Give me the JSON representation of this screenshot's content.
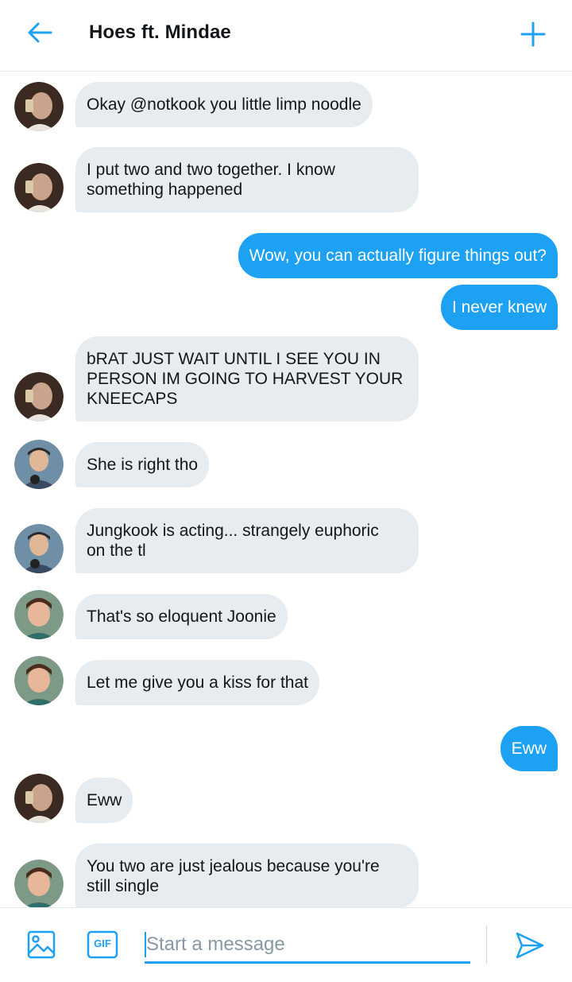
{
  "header": {
    "title": "Hoes ft. Mindae",
    "back_icon": "arrow-left-icon",
    "add_icon": "plus-icon"
  },
  "colors": {
    "accent": "#1da1f2",
    "incoming_bubble": "#e6ecf0",
    "divider": "#e1e8ed"
  },
  "messages": [
    {
      "sender": "a",
      "direction": "in",
      "text": "Okay @notkook you little limp noodle"
    },
    {
      "sender": "a",
      "direction": "in",
      "text": "I put two and two together. I know\nsomething happened"
    },
    {
      "sender": "me",
      "direction": "out",
      "text": "Wow, you can actually figure things out?"
    },
    {
      "sender": "me",
      "direction": "out",
      "text": "I never knew"
    },
    {
      "sender": "a",
      "direction": "in",
      "text": "bRAT JUST WAIT UNTIL I SEE YOU IN\nPERSON IM GOING TO HARVEST YOUR\nKNEECAPS"
    },
    {
      "sender": "b",
      "direction": "in",
      "text": "She is right tho"
    },
    {
      "sender": "b",
      "direction": "in",
      "text": "Jungkook is acting... strangely euphoric\non the tl"
    },
    {
      "sender": "c",
      "direction": "in",
      "text": "That's so eloquent Joonie"
    },
    {
      "sender": "c",
      "direction": "in",
      "text": "Let me give you a kiss for that"
    },
    {
      "sender": "me",
      "direction": "out",
      "text": "Eww"
    },
    {
      "sender": "a",
      "direction": "in",
      "text": "Eww"
    },
    {
      "sender": "c",
      "direction": "in",
      "text": "You two are just jealous because you're\nstill single"
    }
  ],
  "composer": {
    "placeholder": "Start a message",
    "value": "",
    "media_icon": "image-icon",
    "gif_label": "GIF",
    "send_icon": "send-icon"
  }
}
